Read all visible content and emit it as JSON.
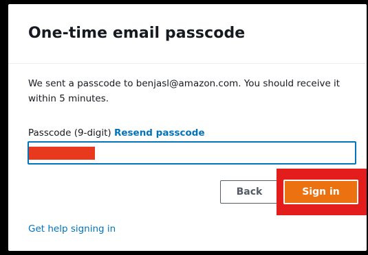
{
  "card": {
    "title": "One-time email passcode",
    "message": "We sent a passcode to benjasl@amazon.com. You should receive it within 5 minutes."
  },
  "passcode_field": {
    "label": "Passcode (9-digit)",
    "resend_link": "Resend passcode",
    "value": ""
  },
  "actions": {
    "back_label": "Back",
    "signin_label": "Sign in"
  },
  "footer": {
    "help_link": "Get help signing in"
  },
  "colors": {
    "link": "#0073bb",
    "primary_button": "#ec7211",
    "highlight": "#e31c1c",
    "redaction": "#e8391f",
    "input_focus_border": "#0073bb"
  }
}
